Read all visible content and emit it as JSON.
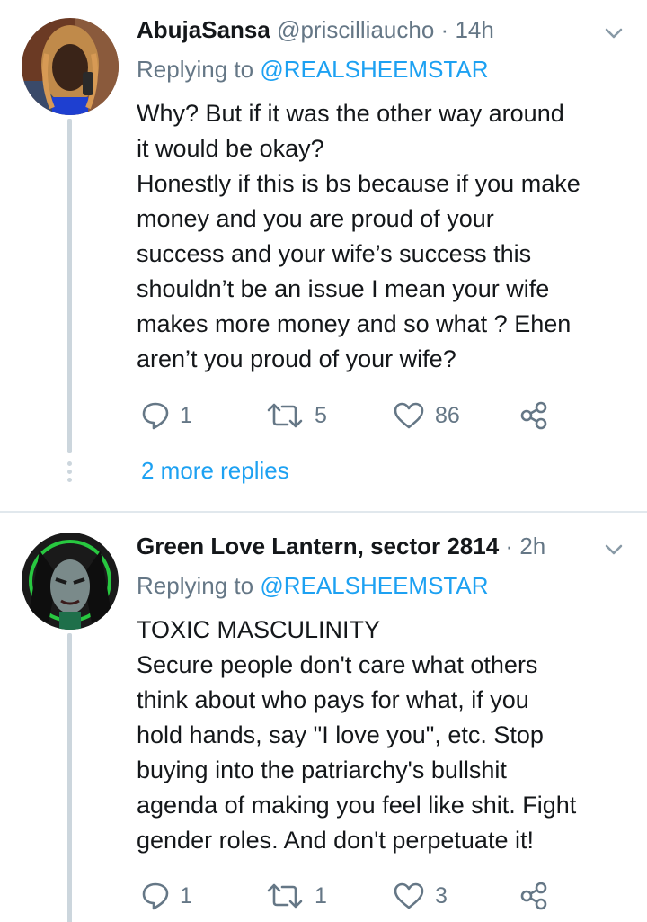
{
  "tweets": [
    {
      "name": "AbujaSansa",
      "handle": "@priscilliaucho",
      "separator": "·",
      "time": "14h",
      "replying_prefix": "Replying to ",
      "replying_mention": "@REALSHEEMSTAR",
      "body": [
        "Why? But if it was the other way around",
        "it would be okay?",
        "Honestly if this is bs because if you make",
        "money and you are proud of your",
        "success and your wife’s success this",
        "shouldn’t be an issue I mean your wife",
        "makes more money and so what ? Ehen",
        "aren’t you proud of your wife?"
      ],
      "replies": "1",
      "retweets": "5",
      "likes": "86",
      "more_replies": "2 more replies"
    },
    {
      "name": "Green Love Lantern, sector 2814",
      "handle": "",
      "separator": "·",
      "time": "2h",
      "replying_prefix": "Replying to ",
      "replying_mention": "@REALSHEEMSTAR",
      "body": [
        "TOXIC MASCULINITY",
        "Secure people don't care what others",
        "think about who pays for what, if you",
        "hold hands, say \"I love you\", etc. Stop",
        "buying into the patriarchy's bullshit",
        "agenda of making you feel like shit. Fight",
        "gender roles. And don't perpetuate it!"
      ],
      "replies": "1",
      "retweets": "1",
      "likes": "3"
    }
  ],
  "colors": {
    "text": "#14171a",
    "secondary": "#657786",
    "link": "#1da1f2",
    "thread_line": "#ccd6dd",
    "divider": "#e1e8ed"
  },
  "icons": {
    "reply": "reply-icon",
    "retweet": "retweet-icon",
    "like": "heart-icon",
    "share": "share-icon",
    "caret": "chevron-down-icon"
  }
}
